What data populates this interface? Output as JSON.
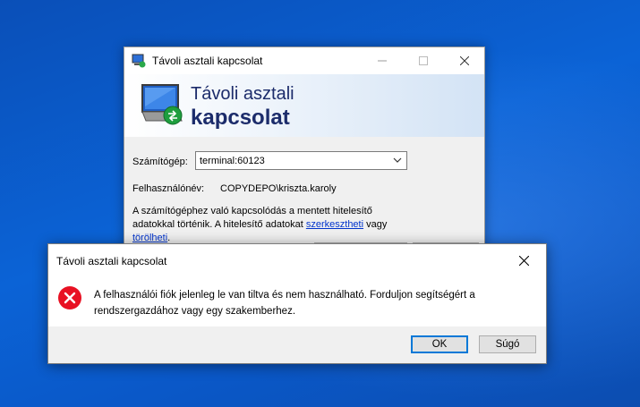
{
  "rdc_window": {
    "title": "Távoli asztali kapcsolat",
    "banner_line1": "Távoli asztali",
    "banner_line2": "kapcsolat",
    "computer_label": "Számítógép:",
    "computer_value": "terminal:60123",
    "username_label": "Felhasználónév:",
    "username_value": "COPYDEPO\\kriszta.karoly",
    "info_text_part1": "A számítógéphez való kapcsolódás a mentett hitelesítő adatokkal történik. A hitelesítő adatokat ",
    "info_link_edit": "szerkesztheti",
    "info_text_part2": " vagy ",
    "info_link_delete": "törölheti",
    "info_text_part3": "."
  },
  "error_dialog": {
    "title": "Távoli asztali kapcsolat",
    "message": "A felhasználói fiók jelenleg le van tiltva és nem használható. Forduljon segítségért a rendszergazdához vagy egy szakemberhez.",
    "ok_label": "OK",
    "help_label": "Súgó"
  },
  "icons": {
    "rdc_title": "remote-desktop-icon",
    "rdc_logo": "remote-desktop-logo-icon",
    "dropdown": "chevron-down-icon",
    "close": "close-icon",
    "minimize": "minimize-icon",
    "maximize": "maximize-icon",
    "error": "error-icon"
  },
  "colors": {
    "desktop_blue": "#0b63d6",
    "banner_text": "#1c2c6b",
    "link": "#0033cc",
    "error_red": "#e81123",
    "focus_blue": "#0078d7"
  }
}
